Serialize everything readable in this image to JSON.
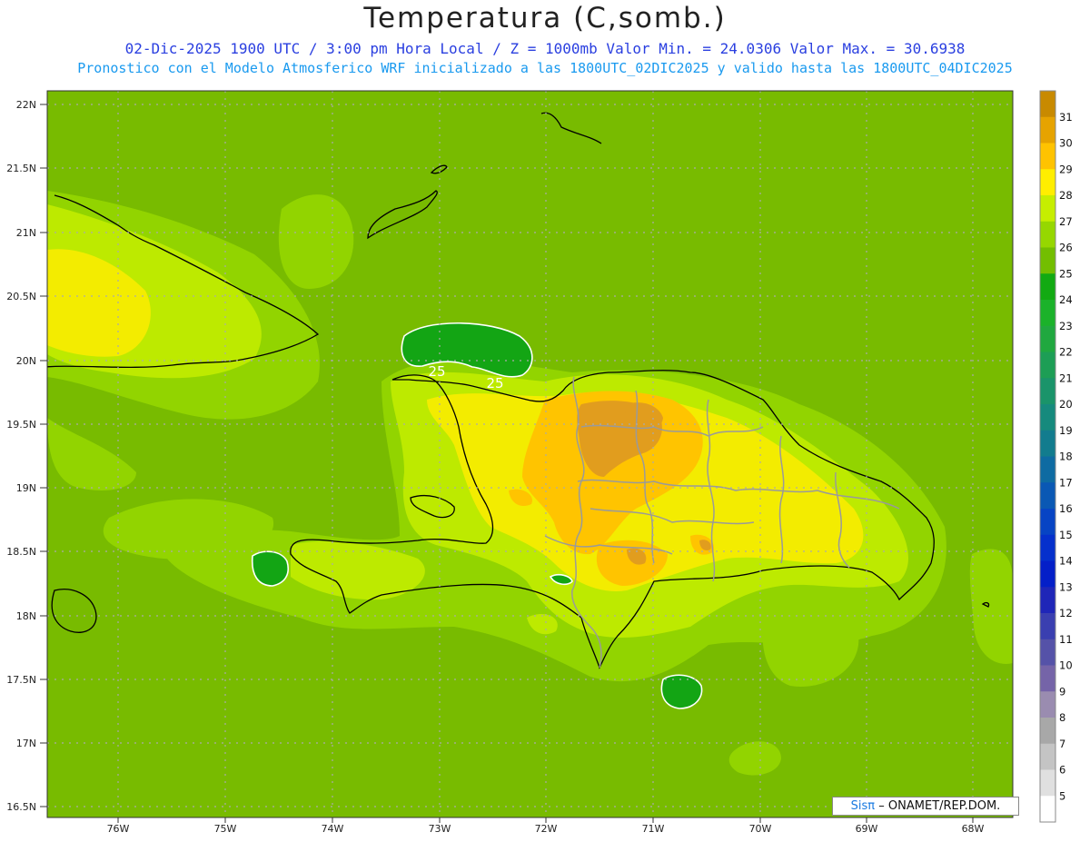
{
  "header": {
    "title": "Temperatura (C,somb.)",
    "line1": "02-Dic-2025  1900 UTC / 3:00 pm Hora Local / Z = 1000mb   Valor Min. = 24.0306  Valor Max. = 30.6938",
    "line2": "Pronostico con el Modelo Atmosferico WRF inicializado a las 1800UTC_02DIC2025 y valido hasta las  1800UTC_04DIC2025"
  },
  "axes": {
    "lat_labels": [
      "22N",
      "21.5N",
      "21N",
      "20.5N",
      "20N",
      "19.5N",
      "19N",
      "18.5N",
      "18N",
      "17.5N",
      "17N",
      "16.5N"
    ],
    "lon_labels": [
      "76W",
      "75W",
      "74W",
      "73W",
      "72W",
      "71W",
      "70W",
      "69W",
      "68W"
    ]
  },
  "contour_labels": [
    "25",
    "25"
  ],
  "colorbar": {
    "labels": [
      "31",
      "30",
      "29",
      "28",
      "27",
      "26",
      "25",
      "24",
      "23",
      "22",
      "21",
      "20",
      "19",
      "18",
      "17",
      "16",
      "15",
      "14",
      "13",
      "12",
      "11",
      "10",
      "9",
      "8",
      "7",
      "6",
      "5"
    ],
    "colors": [
      "#c88a00",
      "#e6a300",
      "#ffc300",
      "#ffee00",
      "#c6ee00",
      "#96d700",
      "#73be00",
      "#12aa12",
      "#1bb22a",
      "#20a83f",
      "#1d9e55",
      "#1a946a",
      "#168a7d",
      "#127c8e",
      "#0e6ba2",
      "#0a58b4",
      "#0744c4",
      "#0530cc",
      "#041fc8",
      "#1f26b8",
      "#3a3fb0",
      "#5552a8",
      "#7564a8",
      "#9a8cb0",
      "#a8a8a8",
      "#c4c4c4",
      "#e0e0e0",
      "#ffffff"
    ]
  },
  "credit": {
    "logo": "Sisπ",
    "text": "– ONAMET/REP.DOM."
  },
  "colors": {
    "ocean": "#78bb00",
    "t26": "#92d400",
    "t27": "#bdea00",
    "t28": "#f3ec00",
    "t29": "#ffc400",
    "t30": "#e19d1e",
    "t24": "#13a514"
  }
}
